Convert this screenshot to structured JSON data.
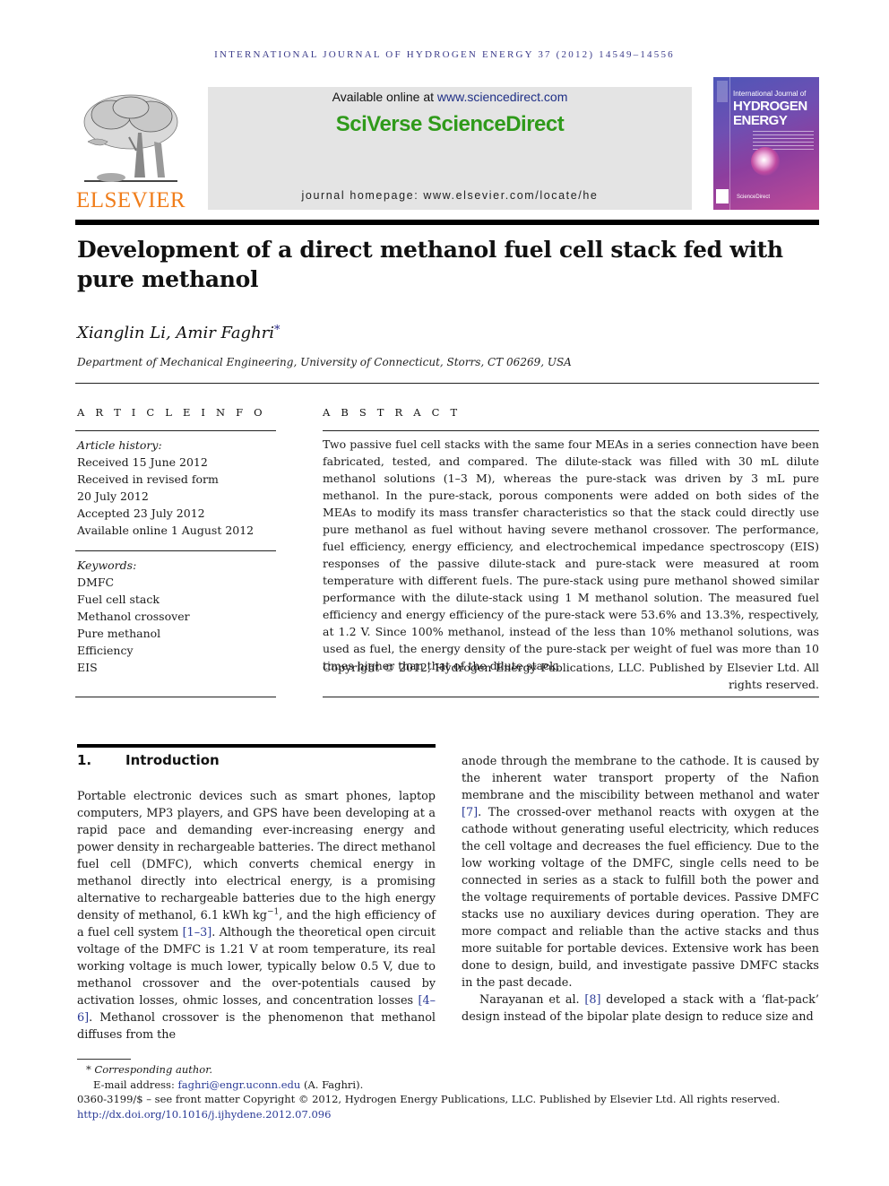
{
  "running_header": "INTERNATIONAL JOURNAL OF HYDROGEN ENERGY 37 (2012) 14549–14556",
  "masthead": {
    "publisher_logo_text": "ELSEVIER",
    "available_online_prefix": "Available online at ",
    "available_online_link": "www.sciencedirect.com",
    "platform_name": "SciVerse ScienceDirect",
    "journal_homepage": "journal homepage: www.elsevier.com/locate/he",
    "cover": {
      "line1": "International Journal of",
      "line2": "HYDROGEN",
      "line3": "ENERGY",
      "footer": "ScienceDirect"
    }
  },
  "colors": {
    "elsevier_orange": "#f07d1a",
    "sciverse_green": "#2f9a1a",
    "link_blue": "#2a3a96",
    "header_blue": "#3b3b8a",
    "masthead_gray": "#e4e4e4"
  },
  "article": {
    "title": "Development of a direct methanol fuel cell stack fed with pure methanol",
    "authors": "Xianglin Li, Amir Faghri",
    "corresponding_marker": "*",
    "affiliation": "Department of Mechanical Engineering, University of Connecticut, Storrs, CT 06269, USA"
  },
  "article_info": {
    "label": "A R T I C L E   I N F O",
    "history_heading": "Article history:",
    "history": [
      "Received 15 June 2012",
      "Received in revised form",
      "20 July 2012",
      "Accepted 23 July 2012",
      "Available online 1 August 2012"
    ],
    "keywords_heading": "Keywords:",
    "keywords": [
      "DMFC",
      "Fuel cell stack",
      "Methanol crossover",
      "Pure methanol",
      "Efficiency",
      "EIS"
    ]
  },
  "abstract": {
    "label": "A B S T R A C T",
    "text": "Two passive fuel cell stacks with the same four MEAs in a series connection have been fabricated, tested, and compared. The dilute-stack was filled with 30 mL dilute methanol solutions (1–3 M), whereas the pure-stack was driven by 3 mL pure methanol. In the pure-stack, porous components were added on both sides of the MEAs to modify its mass transfer characteristics so that the stack could directly use pure methanol as fuel without having severe methanol crossover. The performance, fuel efficiency, energy efficiency, and electrochemical impedance spectroscopy (EIS) responses of the passive dilute-stack and pure-stack were measured at room temperature with different fuels. The pure-stack using pure methanol showed similar performance with the dilute-stack using 1 M methanol solution. The measured fuel efficiency and energy efficiency of the pure-stack were 53.6% and 13.3%, respectively, at 1.2 V. Since 100% methanol, instead of the less than 10% methanol solutions, was used as fuel, the energy density of the pure-stack per weight of fuel was more than 10 times higher than that of the dilute stack.",
    "copyright": "Copyright © 2012, Hydrogen Energy Publications, LLC. Published by Elsevier Ltd. All rights reserved."
  },
  "introduction": {
    "number": "1.",
    "heading": "Introduction",
    "left_p1_a": "Portable electronic devices such as smart phones, laptop computers, MP3 players, and GPS have been developing at a rapid pace and demanding ever-increasing energy and power density in rechargeable batteries. The direct methanol fuel cell (DMFC), which converts chemical energy in methanol directly into electrical energy, is a promising alternative to rechargeable batteries due to the high energy density of methanol, 6.1 kWh kg",
    "left_p1_sup": "−1",
    "left_p1_b": ", and the high efficiency of a fuel cell system ",
    "cite_1_3": "[1–3]",
    "left_p1_c": ". Although the theoretical open circuit voltage of the DMFC is 1.21 V at room temperature, its real working voltage is much lower, typically below 0.5 V, due to methanol crossover and the over-potentials caused by activation losses, ohmic losses, and concentration losses ",
    "cite_4_6": "[4–6]",
    "left_p1_d": ". Methanol crossover is the phenomenon that methanol diffuses from the",
    "right_p1_a": "anode through the membrane to the cathode. It is caused by the inherent water transport property of the Nafion membrane and the miscibility between methanol and water ",
    "cite_7": "[7]",
    "right_p1_b": ". The crossed-over methanol reacts with oxygen at the cathode without generating useful electricity, which reduces the cell voltage and decreases the fuel efficiency. Due to the low working voltage of the DMFC, single cells need to be connected in series as a stack to fulfill both the power and the voltage requirements of portable devices. Passive DMFC stacks use no auxiliary devices during operation. They are more compact and reliable than the active stacks and thus more suitable for portable devices. Extensive work has been done to design, build, and investigate passive DMFC stacks in the past decade.",
    "right_p2_a": "Narayanan et al. ",
    "cite_8": "[8]",
    "right_p2_b": " developed a stack with a ‘flat-pack’ design instead of the bipolar plate design to reduce size and"
  },
  "footnotes": {
    "corresponding": "* Corresponding author.",
    "email_label": "E-mail address: ",
    "email": "faghri@engr.uconn.edu",
    "email_suffix": " (A. Faghri).",
    "front_matter": "0360-3199/$ – see front matter Copyright © 2012, Hydrogen Energy Publications, LLC. Published by Elsevier Ltd. All rights reserved.",
    "doi": "http://dx.doi.org/10.1016/j.ijhydene.2012.07.096"
  }
}
